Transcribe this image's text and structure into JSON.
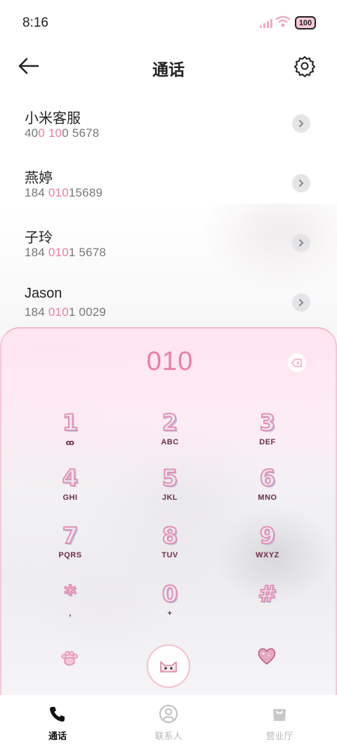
{
  "status_bar": {
    "time": "8:16",
    "battery": "100"
  },
  "header": {
    "title": "通话"
  },
  "contacts": [
    {
      "name": "小米客服",
      "number_parts": [
        "40",
        "0",
        " ",
        "10",
        "0 5678"
      ]
    },
    {
      "name": "燕婷",
      "number_parts": [
        "184 ",
        "010",
        "",
        "",
        "15689"
      ]
    },
    {
      "name": "子玲",
      "number_parts": [
        "184 ",
        "010",
        "1 5678",
        "",
        ""
      ]
    },
    {
      "name": "Jason",
      "number_parts": [
        "184 ",
        "010",
        "1 0029",
        "",
        ""
      ]
    }
  ],
  "dialer": {
    "input_value": "010",
    "keys": [
      {
        "digit": "1",
        "letters": "ꝏ"
      },
      {
        "digit": "2",
        "letters": "ABC"
      },
      {
        "digit": "3",
        "letters": "DEF"
      },
      {
        "digit": "4",
        "letters": "GHI"
      },
      {
        "digit": "5",
        "letters": "JKL"
      },
      {
        "digit": "6",
        "letters": "MNO"
      },
      {
        "digit": "7",
        "letters": "PQRS"
      },
      {
        "digit": "8",
        "letters": "TUV"
      },
      {
        "digit": "9",
        "letters": "WXYZ"
      },
      {
        "digit": "*",
        "letters": ","
      },
      {
        "digit": "0",
        "letters": "+"
      },
      {
        "digit": "#",
        "letters": ""
      }
    ]
  },
  "bottom_nav": [
    {
      "label": "通话",
      "icon": "phone-icon",
      "active": true
    },
    {
      "label": "联系人",
      "icon": "person-icon",
      "active": false
    },
    {
      "label": "营业厅",
      "icon": "bag-icon",
      "active": false
    }
  ],
  "colors": {
    "accent_pink": "#ec7ea8",
    "label_dark": "#6f2b46"
  }
}
